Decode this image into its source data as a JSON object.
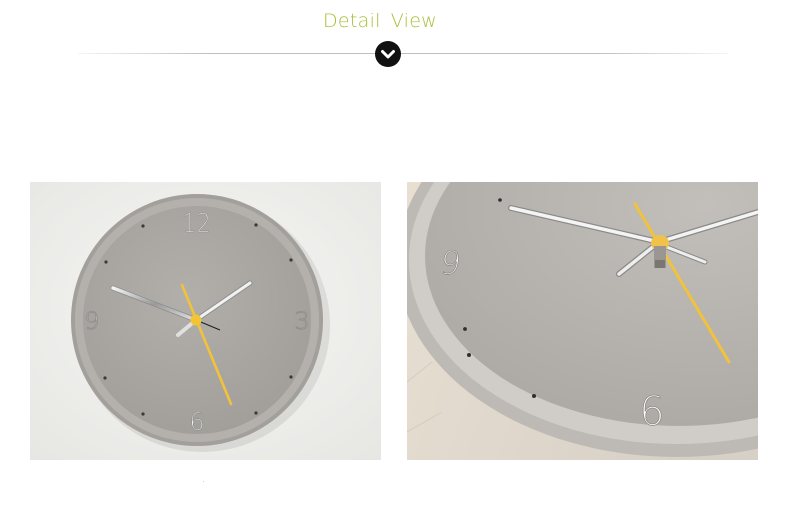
{
  "header": {
    "title_word_1": "Detail",
    "title_word_2": "View",
    "title_color": "#a8c03a",
    "chevron_icon": "chevron-down-icon"
  },
  "images": [
    {
      "name": "clock-front-photo",
      "numerals": [
        "12",
        "3",
        "6",
        "9"
      ],
      "face_color": "#a9a6a1",
      "second_hand_color": "#f1c23a"
    },
    {
      "name": "clock-closeup-photo",
      "numerals": [
        "9",
        "6"
      ],
      "face_color": "#b6b3ae",
      "second_hand_color": "#f1c23a"
    }
  ]
}
